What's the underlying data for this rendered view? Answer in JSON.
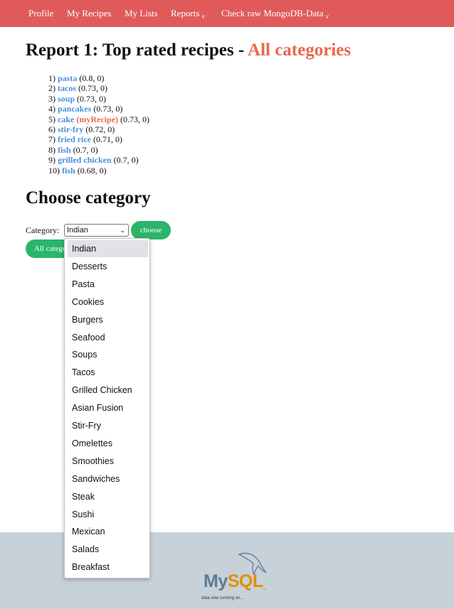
{
  "nav": {
    "items": [
      "Profile",
      "My Recipes",
      "My Lists",
      "Reports",
      "Check raw MongoDB-Data"
    ],
    "caret": "v"
  },
  "report": {
    "title_prefix": "Report 1: Top rated recipes - ",
    "category": "All categories"
  },
  "ranking": [
    {
      "rank": "1)",
      "name": "pasta",
      "score": "(0.8, 0)"
    },
    {
      "rank": "2)",
      "name": "tacos",
      "score": "(0.73, 0)"
    },
    {
      "rank": "3)",
      "name": "soup",
      "score": "(0.73, 0)"
    },
    {
      "rank": "4)",
      "name": "pancakes",
      "score": "(0.73, 0)"
    },
    {
      "rank": "5)",
      "name": "cake",
      "tag": "(myRecipe)",
      "score": "(0.73, 0)"
    },
    {
      "rank": "6)",
      "name": "stir-fry",
      "score": "(0.72, 0)"
    },
    {
      "rank": "7)",
      "name": "fried rice",
      "score": "(0.71, 0)"
    },
    {
      "rank": "8)",
      "name": "fish",
      "score": "(0.7, 0)"
    },
    {
      "rank": "9)",
      "name": "grilled chicken",
      "score": "(0.7, 0)"
    },
    {
      "rank": "10)",
      "name": "fish",
      "score": "(0.68, 0)"
    }
  ],
  "choose": {
    "title": "Choose category",
    "label": "Category:",
    "selected": "Indian",
    "choose_button": "choose",
    "all_button": "All categories"
  },
  "dropdown_options": [
    "Indian",
    "Desserts",
    "Pasta",
    "Cookies",
    "Burgers",
    "Seafood",
    "Soups",
    "Tacos",
    "Grilled Chicken",
    "Asian Fusion",
    "Stir-Fry",
    "Omelettes",
    "Smoothies",
    "Sandwiches",
    "Steak",
    "Sushi",
    "Mexican",
    "Salads",
    "Breakfast"
  ],
  "footer": {
    "logo_my": "My",
    "logo_sql": "SQL",
    "logo_tm": "™",
    "tagline": "data now running on..."
  }
}
